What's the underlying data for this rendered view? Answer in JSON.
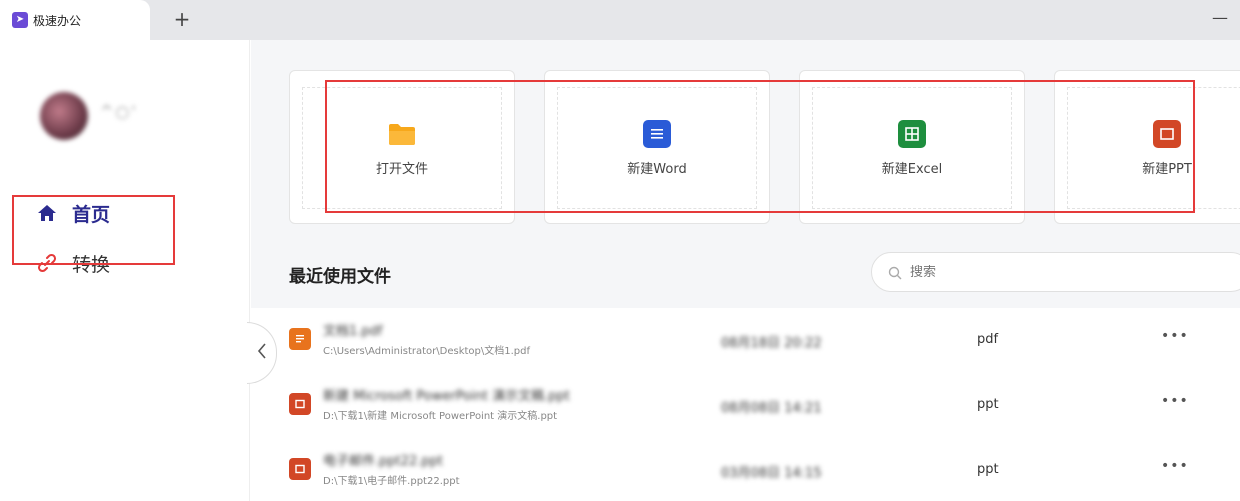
{
  "tab": {
    "title": "极速办公",
    "new_tab": "+",
    "minimize": "—"
  },
  "user": {
    "name": "^○'"
  },
  "nav": [
    {
      "label": "首页"
    },
    {
      "label": "转换"
    }
  ],
  "cards": [
    {
      "label": "打开文件",
      "icon": "folder-icon",
      "color": "#f5a623"
    },
    {
      "label": "新建Word",
      "icon": "word-doc-icon",
      "color": "#2a5bd7"
    },
    {
      "label": "新建Excel",
      "icon": "excel-sheet-icon",
      "color": "#1e8e3e"
    },
    {
      "label": "新建PPT",
      "icon": "ppt-slide-icon",
      "color": "#d24726"
    }
  ],
  "recent": {
    "title": "最近使用文件",
    "search_placeholder": "搜索"
  },
  "files": [
    {
      "name": "文档1.pdf",
      "path": "C:\\Users\\Administrator\\Desktop\\文档1.pdf",
      "time": "08月18日 20:22",
      "type": "pdf",
      "more": "•••",
      "icon": "pdf-file-icon",
      "color": "#e8731d"
    },
    {
      "name": "新建 Microsoft PowerPoint 演示文稿.ppt",
      "path": "D:\\下载1\\新建 Microsoft PowerPoint 演示文稿.ppt",
      "time": "08月08日 14:21",
      "type": "ppt",
      "more": "•••",
      "icon": "ppt-file-icon",
      "color": "#d24726"
    },
    {
      "name": "电子邮件.ppt22.ppt",
      "path": "D:\\下载1\\电子邮件.ppt22.ppt",
      "time": "03月08日 14:15",
      "type": "ppt",
      "more": "•••",
      "icon": "ppt-file-icon",
      "color": "#d24726"
    }
  ]
}
